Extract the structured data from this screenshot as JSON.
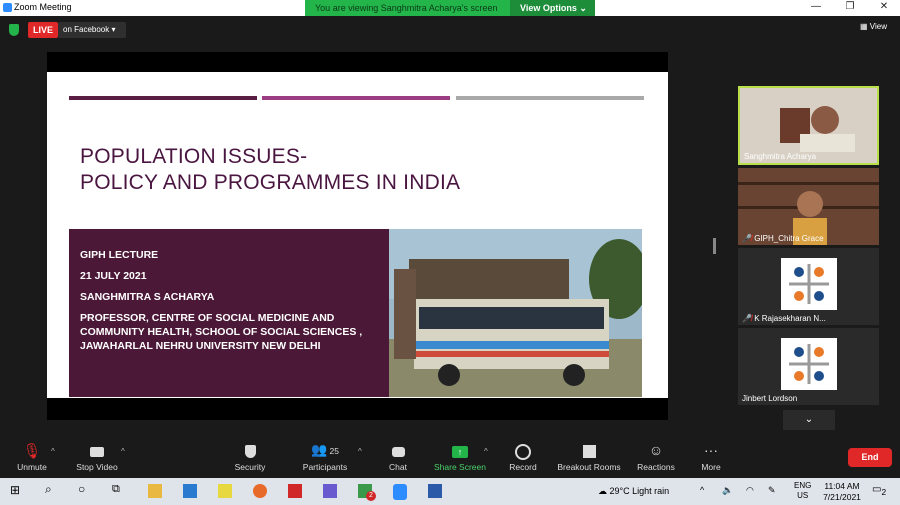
{
  "window": {
    "title": "Zoom Meeting"
  },
  "banner": {
    "message": "You are viewing Sanghmitra Acharya's screen",
    "view_options": "View Options"
  },
  "meeting_bar": {
    "live": "LIVE",
    "platform": "on Facebook",
    "view": "View"
  },
  "slide": {
    "title_line1": "POPULATION ISSUES-",
    "title_line2": "POLICY AND PROGRAMMES IN INDIA",
    "lecture": "GIPH LECTURE",
    "date": "21 JULY 2021",
    "speaker": "SANGHMITRA S ACHARYA",
    "affil_1": "PROFESSOR, CENTRE OF SOCIAL MEDICINE AND",
    "affil_2": "COMMUNITY HEALTH, SCHOOL OF SOCIAL SCIENCES ,",
    "affil_3": "JAWAHARLAL NEHRU UNIVERSITY NEW DELHI"
  },
  "participants": [
    {
      "name": "Sanghmitra Acharya"
    },
    {
      "name": "GIPH_Chitra Grace"
    },
    {
      "name": "K Rajasekharan N..."
    },
    {
      "name": "Jinbert Lordson"
    }
  ],
  "toolbar": {
    "unmute": "Unmute",
    "stop_video": "Stop Video",
    "security": "Security",
    "participants": "Participants",
    "participants_count": "25",
    "chat": "Chat",
    "share_screen": "Share Screen",
    "record": "Record",
    "breakout": "Breakout Rooms",
    "reactions": "Reactions",
    "more": "More",
    "end": "End"
  },
  "taskbar": {
    "weather": "29°C  Light rain",
    "lang1": "ENG",
    "lang2": "US",
    "time": "11:04 AM",
    "date": "7/21/2021",
    "badge": "2",
    "notif": "2"
  },
  "colors": {
    "accent_green": "#23b54a",
    "end_red": "#e02828",
    "slide_maroon": "#4c1838"
  }
}
